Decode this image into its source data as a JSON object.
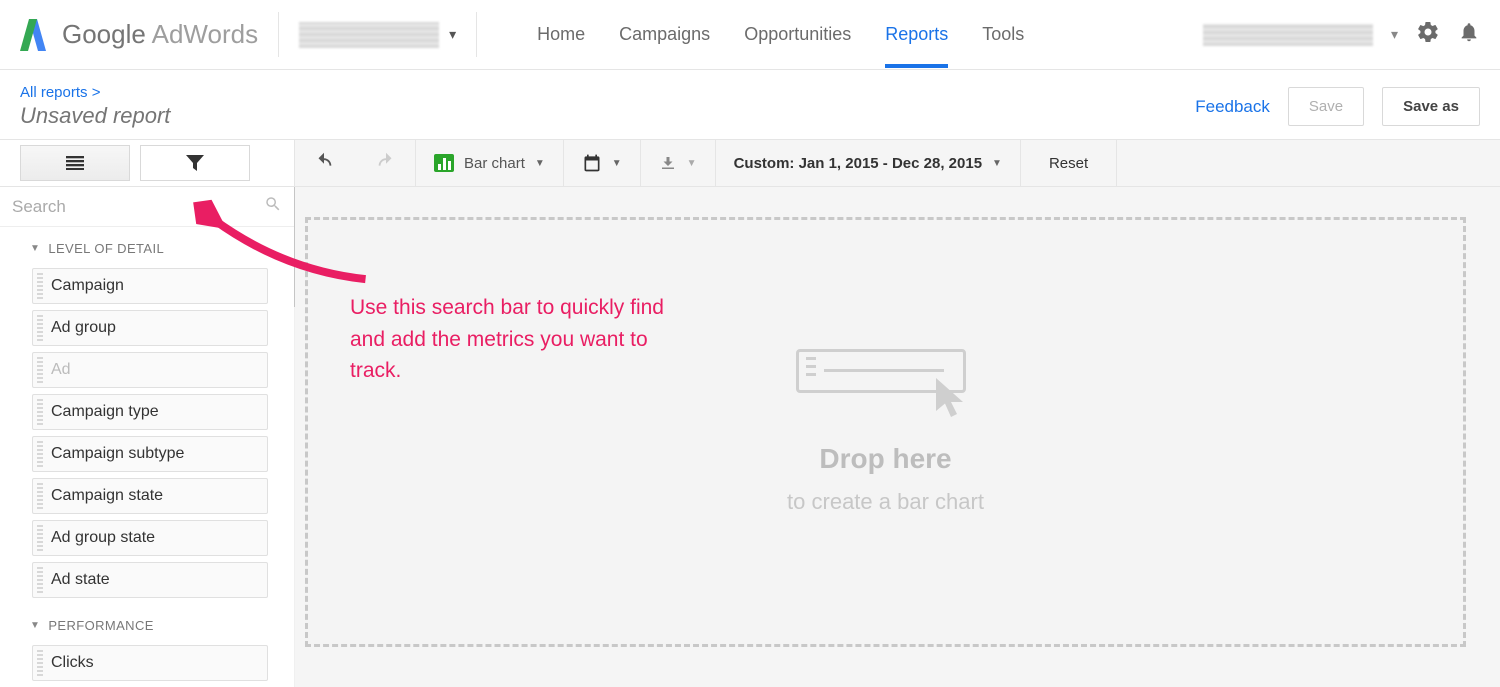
{
  "header": {
    "logo_text_google": "Google",
    "logo_text_adwords": " AdWords",
    "nav": [
      "Home",
      "Campaigns",
      "Opportunities",
      "Reports",
      "Tools"
    ],
    "nav_active_index": 3
  },
  "subheader": {
    "breadcrumb": "All reports >",
    "report_title": "Unsaved report",
    "feedback": "Feedback",
    "save": "Save",
    "save_as": "Save as"
  },
  "toolbar": {
    "chart_type": "Bar chart",
    "date_range": "Custom: Jan 1, 2015 - Dec 28, 2015",
    "reset": "Reset"
  },
  "sidebar": {
    "search_placeholder": "Search",
    "sections": [
      {
        "title": "LEVEL OF DETAIL",
        "items": [
          "Campaign",
          "Ad group",
          "Ad",
          "Campaign type",
          "Campaign subtype",
          "Campaign state",
          "Ad group state",
          "Ad state"
        ],
        "disabled": [
          2
        ]
      },
      {
        "title": "PERFORMANCE",
        "items": [
          "Clicks"
        ]
      }
    ]
  },
  "dropzone": {
    "title": "Drop here",
    "subtitle": "to create a bar chart"
  },
  "annotation": {
    "text": "Use this search bar to quickly  find and add the metrics you want to track."
  }
}
